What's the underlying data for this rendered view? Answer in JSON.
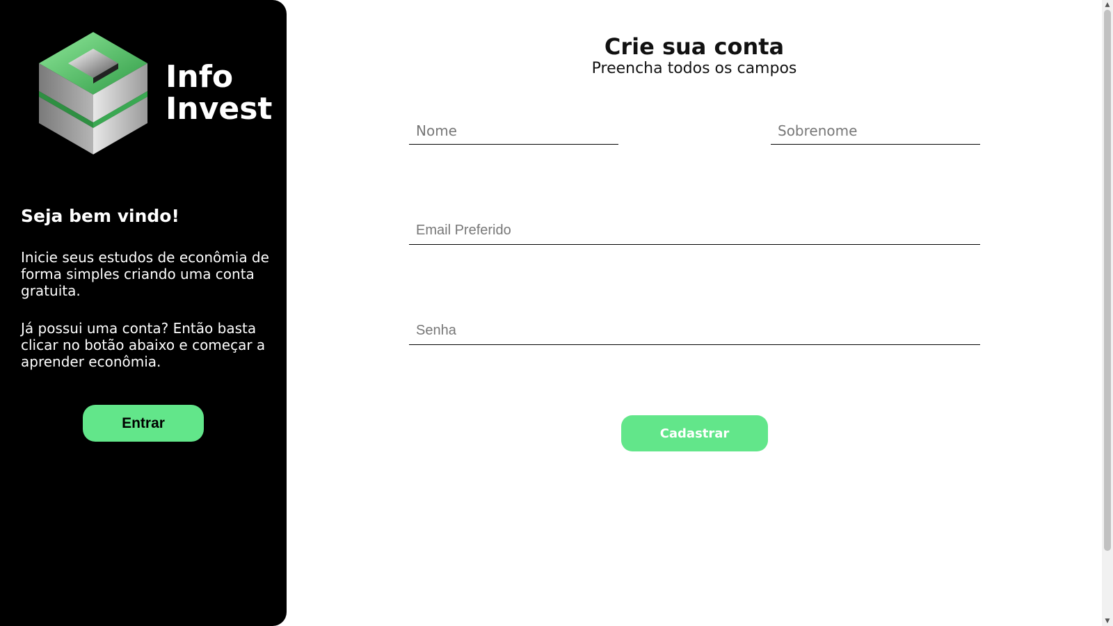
{
  "colors": {
    "sidebar_background": "#000000",
    "accent_green": "#62e68a",
    "text_dark": "#111111"
  },
  "sidebar": {
    "logo_icon": "cube-logo-icon",
    "brand_line1": "Info",
    "brand_line2": "Invest",
    "welcome_title": "Seja bem vindo!",
    "intro_text": "Inicie seus estudos de econômia de forma simples criando uma conta gratuita.",
    "login_text": "Já possui uma conta? Então basta clicar no botão abaixo e começar a aprender econômia.",
    "enter_button_label": "Entrar"
  },
  "form": {
    "title": "Crie sua conta",
    "subtitle": "Preencha todos os campos",
    "fields": {
      "name": {
        "placeholder": "Nome",
        "value": ""
      },
      "surname": {
        "placeholder": "Sobrenome",
        "value": ""
      },
      "email": {
        "placeholder": "Email Preferido",
        "value": ""
      },
      "password": {
        "placeholder": "Senha",
        "value": ""
      }
    },
    "register_button_label": "Cadastrar"
  }
}
